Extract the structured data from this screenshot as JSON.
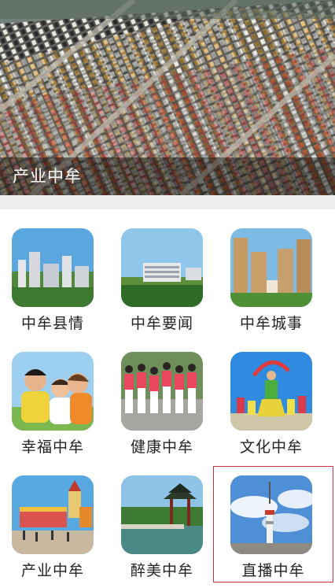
{
  "hero": {
    "caption": "产业中牟",
    "image": "parking-lot-aerial-photo"
  },
  "grid": {
    "tiles": [
      {
        "label": "中牟县情",
        "image": "city-skyline-photo"
      },
      {
        "label": "中牟要闻",
        "image": "government-building-photo"
      },
      {
        "label": "中牟城事",
        "image": "residential-towers-photo"
      },
      {
        "label": "幸福中牟",
        "image": "happy-family-photo"
      },
      {
        "label": "健康中牟",
        "image": "group-exercise-photo"
      },
      {
        "label": "文化中牟",
        "image": "folk-dance-photo"
      },
      {
        "label": "产业中牟",
        "image": "theme-park-photo"
      },
      {
        "label": "醉美中牟",
        "image": "lake-pavilion-photo"
      },
      {
        "label": "直播中牟",
        "image": "tv-tower-photo"
      }
    ],
    "selected_index": 8,
    "selection_color": "#c8323c"
  }
}
